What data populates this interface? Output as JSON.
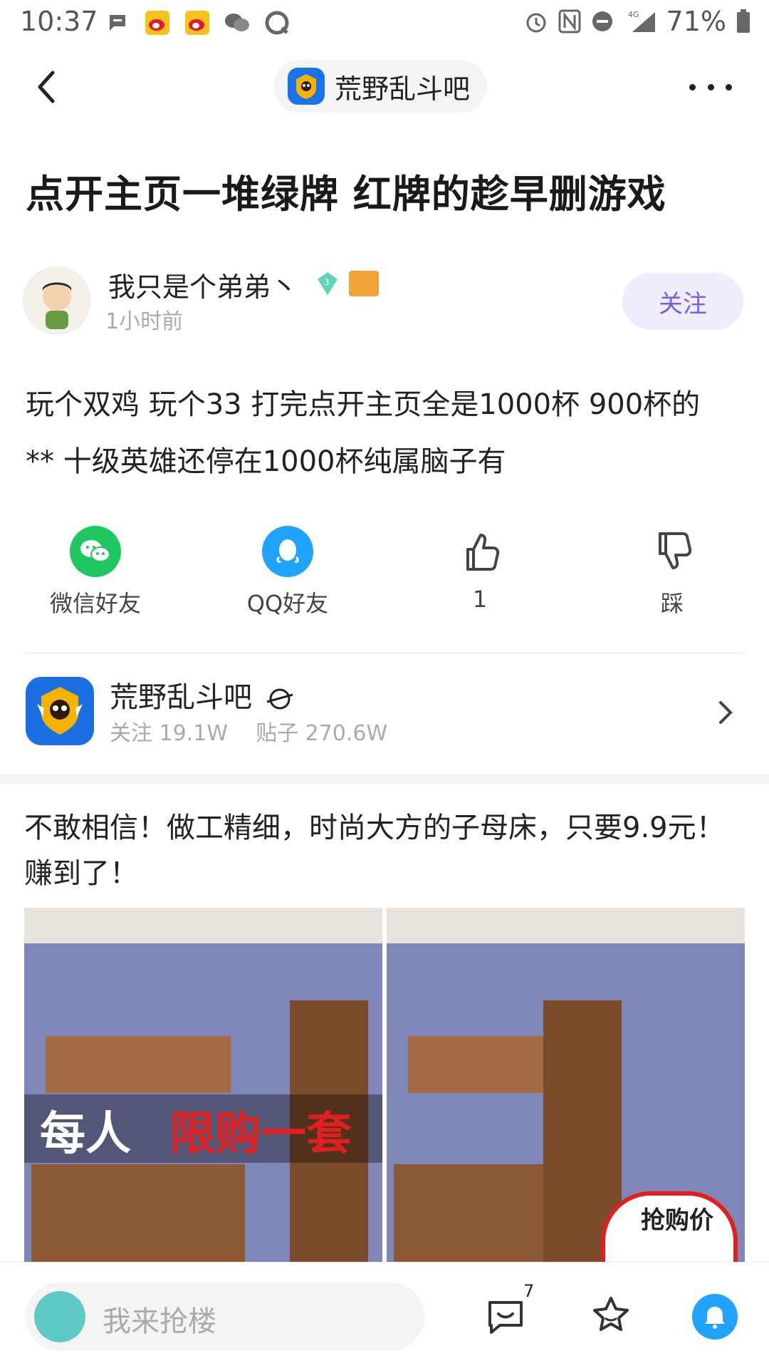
{
  "status_bar": {
    "time": "10:37",
    "battery": "71%",
    "network": "4G"
  },
  "nav": {
    "forum_name": "荒野乱斗吧"
  },
  "post": {
    "title": "点开主页一堆绿牌 红牌的趁早删游戏",
    "author": "我只是个弟弟丶",
    "level": "3",
    "time": "1小时前",
    "follow_label": "关注",
    "content_line1": "玩个双鸡 玩个33 打完点开主页全是1000杯 900杯的",
    "content_line2": "** 十级英雄还停在1000杯纯属脑子有"
  },
  "actions": {
    "wechat_label": "微信好友",
    "qq_label": "QQ好友",
    "like_count": "1",
    "dislike_label": "踩"
  },
  "forum_card": {
    "name": "荒野乱斗吧",
    "followers": "关注 19.1W",
    "posts": "贴子 270.6W"
  },
  "ad": {
    "text": "不敢相信！做工精细，时尚大方的子母床，只要9.9元！赚到了！",
    "banner_white": "每人",
    "banner_red": "限购一套",
    "price_label": "抢购价"
  },
  "bottom_bar": {
    "reply_placeholder": "我来抢楼",
    "comment_count": "7"
  },
  "colors": {
    "accent_purple": "#7a5cf0",
    "wechat_green": "#1fc760",
    "qq_blue": "#1fa3ff"
  }
}
